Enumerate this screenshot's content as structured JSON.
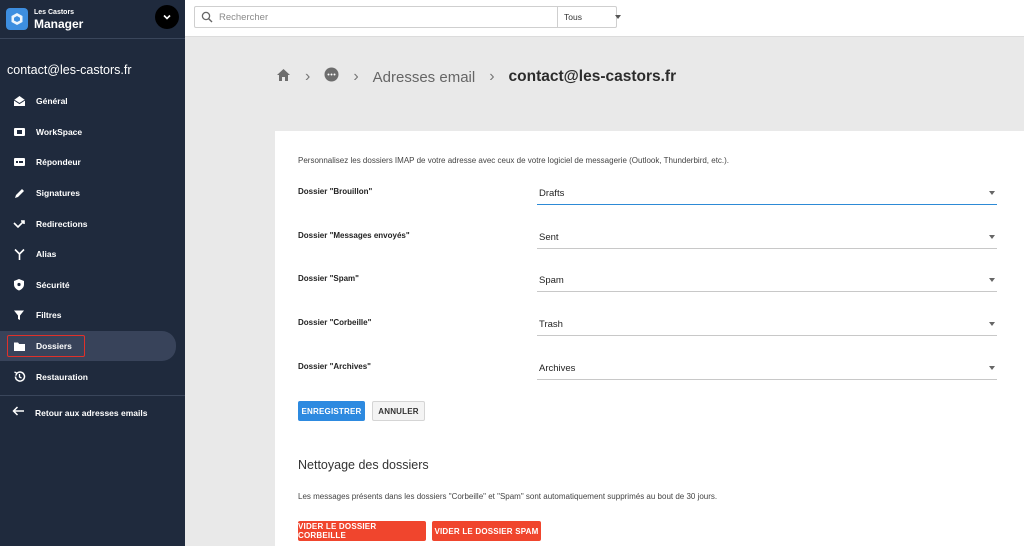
{
  "brand": {
    "small": "Les Castors",
    "big": "Manager"
  },
  "account": "contact@les-castors.fr",
  "nav": [
    {
      "label": "Général",
      "icon": "envelope-open-icon"
    },
    {
      "label": "WorkSpace",
      "icon": "workspace-icon"
    },
    {
      "label": "Répondeur",
      "icon": "autoreply-icon"
    },
    {
      "label": "Signatures",
      "icon": "pen-icon"
    },
    {
      "label": "Redirections",
      "icon": "redirect-icon"
    },
    {
      "label": "Alias",
      "icon": "alias-icon"
    },
    {
      "label": "Sécurité",
      "icon": "shield-icon"
    },
    {
      "label": "Filtres",
      "icon": "filter-icon"
    },
    {
      "label": "Dossiers",
      "icon": "folder-icon",
      "active": true
    },
    {
      "label": "Restauration",
      "icon": "history-icon"
    }
  ],
  "back_label": "Retour aux adresses emails",
  "search": {
    "placeholder": "Rechercher",
    "scope": "Tous"
  },
  "breadcrumb": {
    "section": "Adresses email",
    "current": "contact@les-castors.fr"
  },
  "form": {
    "intro": "Personnalisez les dossiers IMAP de votre adresse avec ceux de votre logiciel de messagerie (Outlook, Thunderbird, etc.).",
    "rows": [
      {
        "label": "Dossier \"Brouillon\"",
        "value": "Drafts"
      },
      {
        "label": "Dossier \"Messages envoyés\"",
        "value": "Sent"
      },
      {
        "label": "Dossier \"Spam\"",
        "value": "Spam"
      },
      {
        "label": "Dossier \"Corbeille\"",
        "value": "Trash"
      },
      {
        "label": "Dossier \"Archives\"",
        "value": "Archives"
      }
    ],
    "save_label": "ENREGISTRER",
    "cancel_label": "ANNULER"
  },
  "cleanup": {
    "title": "Nettoyage des dossiers",
    "description": "Les messages présents dans les dossiers \"Corbeille\" et \"Spam\" sont automatiquement supprimés au bout de 30 jours.",
    "empty_trash_label": "VIDER LE DOSSIER CORBEILLE",
    "empty_spam_label": "VIDER LE DOSSIER SPAM"
  },
  "colors": {
    "sidebar": "#1f2a3d",
    "primary": "#2d8ae0",
    "danger": "#f0452d",
    "highlight": "#e0312a"
  }
}
